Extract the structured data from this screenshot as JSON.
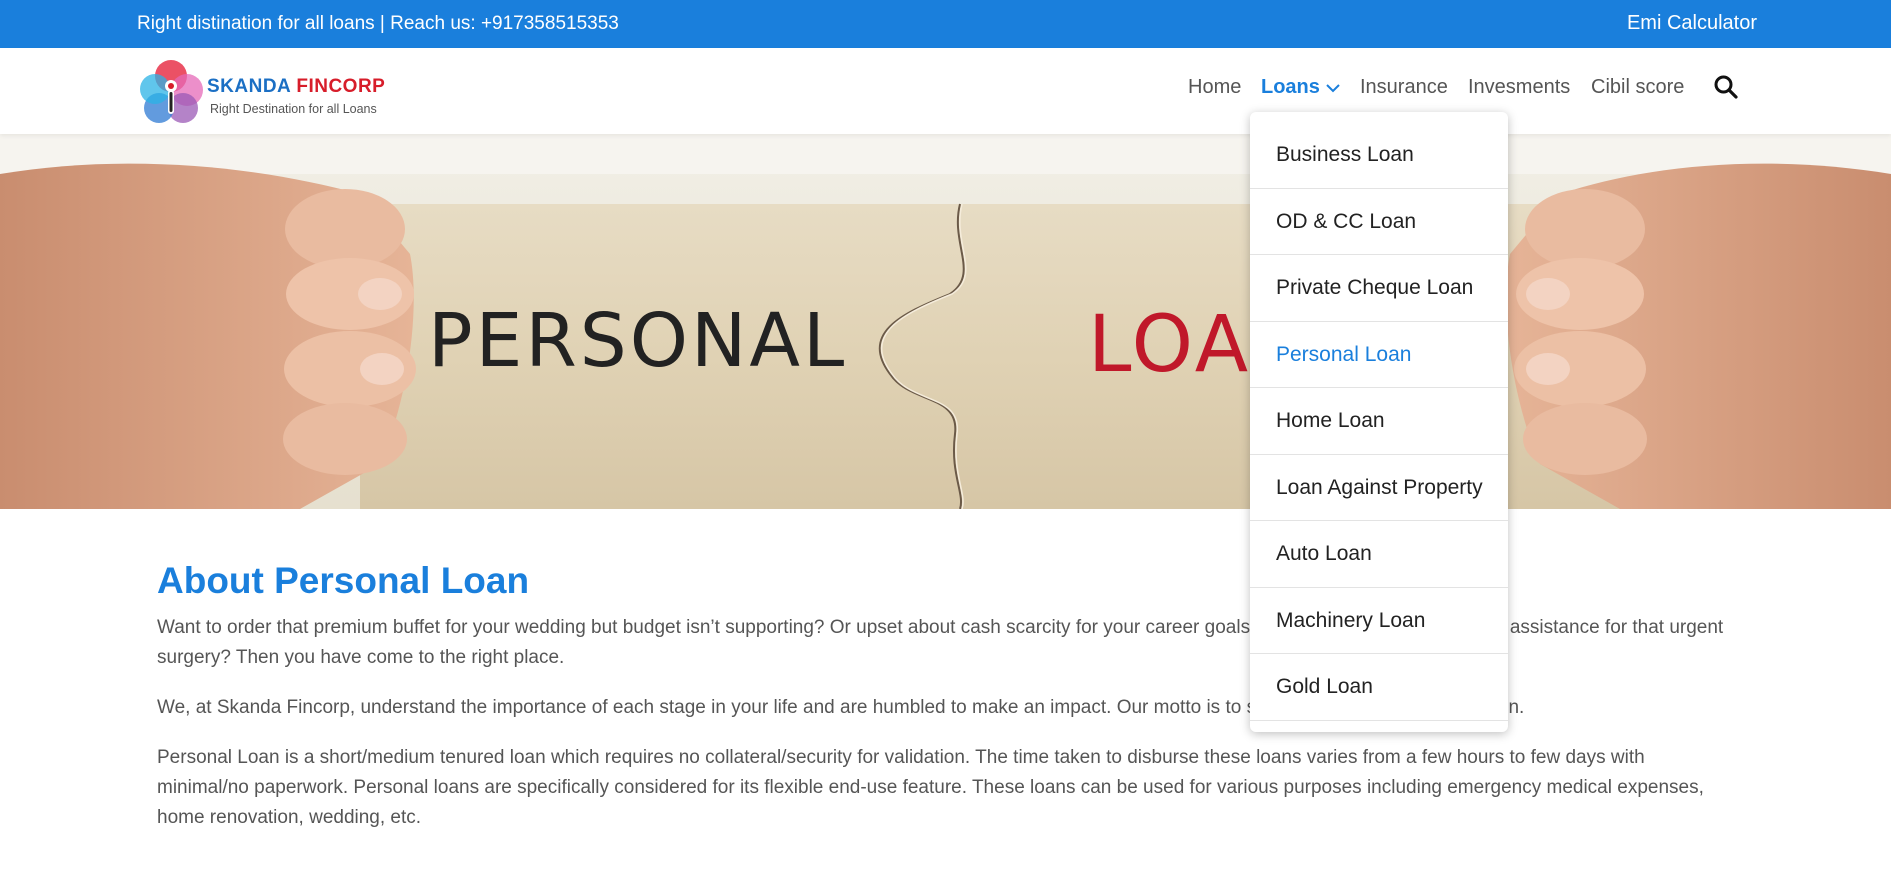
{
  "topbar": {
    "tagline": "Right distination for all loans | Reach us: +917358515353",
    "emi_calculator": "Emi Calculator"
  },
  "brand": {
    "name_part1": "SKANDA",
    "name_part2": "FINCORP",
    "tagline": "Right Destination for all Loans"
  },
  "nav": {
    "items": [
      {
        "label": "Home",
        "active": false
      },
      {
        "label": "Loans",
        "active": true
      },
      {
        "label": "Insurance",
        "active": false
      },
      {
        "label": "Invesments",
        "active": false
      },
      {
        "label": "Cibil score",
        "active": false
      }
    ],
    "search_icon": "search-icon"
  },
  "hero": {
    "word1": "PERSONAL",
    "word2": "LOAN"
  },
  "dropdown": {
    "items": [
      {
        "label": "Business Loan"
      },
      {
        "label": "OD & CC Loan"
      },
      {
        "label": "Private Cheque Loan"
      },
      {
        "label": "Personal Loan",
        "current": true
      },
      {
        "label": "Home Loan"
      },
      {
        "label": "Loan Against Property"
      },
      {
        "label": "Auto Loan"
      },
      {
        "label": "Machinery Loan"
      },
      {
        "label": "Gold Loan"
      }
    ]
  },
  "content": {
    "heading": "About Personal Loan",
    "paragraphs": [
      "Want to order that premium buffet for your wedding but budget isn’t supporting? Or upset about cash scarcity for your career goals? Or looking for quick financial assistance for that urgent surgery? Then you have come to the right place.",
      "We, at Skanda Fincorp, understand the importance of each stage in your life and are humbled to make an impact. Our motto is to serve you with the right intention.",
      "Personal Loan is a short/medium tenured loan which requires no collateral/security for validation. The time taken to disburse these loans varies from a few hours to few days with minimal/no paperwork. Personal loans are specifically considered for its flexible end-use feature. These loans can be used for various purposes including emergency medical expenses, home renovation, wedding, etc."
    ]
  },
  "colors": {
    "accent": "#1a7fdc",
    "brand_blue": "#1b6fc4",
    "brand_red": "#d71d2a",
    "body_text": "#555555"
  }
}
